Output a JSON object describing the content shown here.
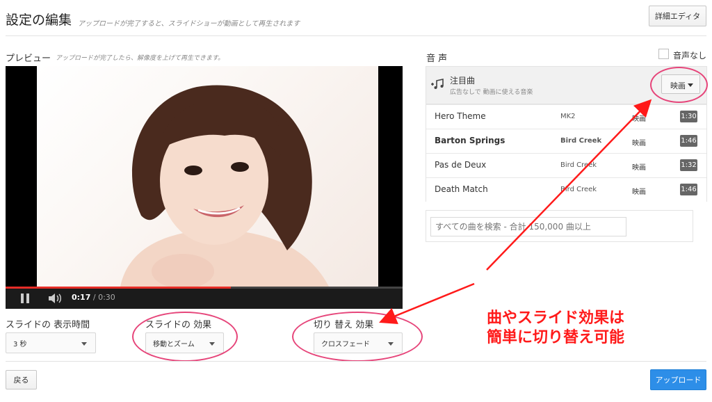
{
  "header": {
    "title": "設定の編集",
    "subtitle": "アップロードが完了すると、スライドショーが動画として再生されます",
    "advanced_editor_label": "詳細エディタ"
  },
  "preview": {
    "title": "プレビュー",
    "subtitle": "アップロードが完了したら、解像度を上げて再生できます。",
    "current_time": "0:17",
    "duration": " / 0:30",
    "progress_fraction": 0.567,
    "icons": [
      "pause-icon",
      "volume-icon"
    ]
  },
  "settings": {
    "duration_label": "スライドの 表示時間",
    "duration_value": "3 秒",
    "effect_label": "スライドの 効果",
    "effect_value": "移動とズーム",
    "transition_label": "切り 替え 効果",
    "transition_value": "クロスフェード"
  },
  "footer": {
    "back_label": "戻る",
    "upload_label": "アップロード"
  },
  "audio": {
    "title": "音 声",
    "no_audio_label": "音声なし",
    "featured_title": "注目曲",
    "featured_desc": "広告なしで 動画に使える音楽",
    "genre_label": "映画",
    "tracks": [
      {
        "name": "Hero Theme",
        "artist": "MK2",
        "genre": "映画",
        "duration": "1:30"
      },
      {
        "name": "Barton Springs",
        "artist": "Bird Creek",
        "genre": "映画",
        "duration": "1:46"
      },
      {
        "name": "Pas de Deux",
        "artist": "Bird Creek",
        "genre": "映画",
        "duration": "1:32"
      },
      {
        "name": "Death Match",
        "artist": "Bird Creek",
        "genre": "映画",
        "duration": "1:46"
      }
    ],
    "search_placeholder": "すべての曲を検索 - 合計 150,000 曲以上"
  },
  "annotation": {
    "line1": "曲やスライド効果は",
    "line2": "簡単に切り替え可能"
  },
  "colors": {
    "accent": "#2d8ee8",
    "annotation": "#ff1a1a",
    "progress": "#e52d27",
    "highlight": "#e6457a"
  }
}
